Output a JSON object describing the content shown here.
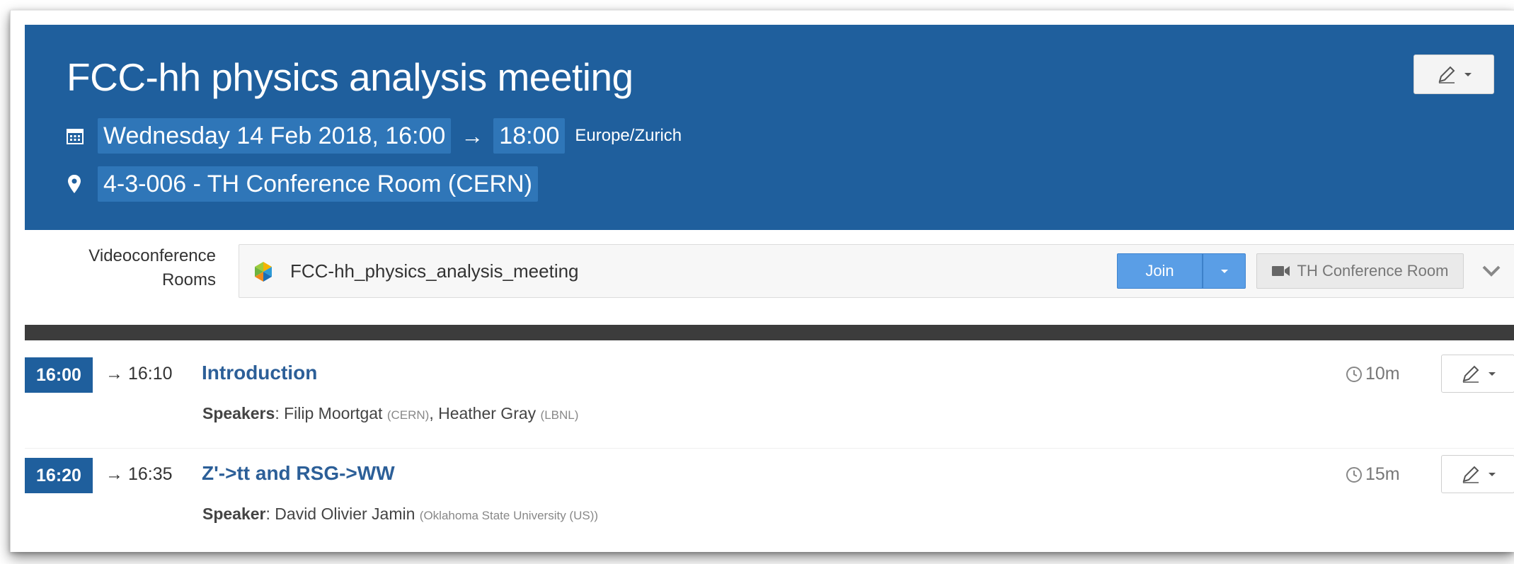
{
  "event": {
    "title": "FCC-hh physics analysis meeting",
    "date_start": "Wednesday 14 Feb 2018, 16:00",
    "arrow": "→",
    "time_end": "18:00",
    "timezone": "Europe/Zurich",
    "location": "4-3-006 - TH Conference Room (CERN)"
  },
  "videoconference": {
    "label": "Videoconference Rooms",
    "room_name": "FCC-hh_physics_analysis_meeting",
    "join_label": "Join",
    "room_button_label": "TH Conference Room"
  },
  "contributions": [
    {
      "start": "16:00",
      "end": "→ 16:10",
      "title": "Introduction",
      "speakers_label": "Speakers",
      "speakers": [
        {
          "name": "Filip Moortgat",
          "affiliation": "(CERN)"
        },
        {
          "name": "Heather Gray",
          "affiliation": "(LBNL)"
        }
      ],
      "duration": "10m"
    },
    {
      "start": "16:20",
      "end": "→ 16:35",
      "title": "Z'->tt and RSG->WW",
      "speakers_label": "Speaker",
      "speakers": [
        {
          "name": "David Olivier Jamin",
          "affiliation": "(Oklahoma State University (US))"
        }
      ],
      "duration": "15m"
    }
  ],
  "colors": {
    "header_bg": "#1f5f9d",
    "highlight_bg": "#2f76b8",
    "join_bg": "#5a9ee6",
    "title_link": "#2c5f98",
    "separator": "#3c3c3c"
  },
  "icons": {
    "calendar": "calendar-icon",
    "location": "map-pin-icon",
    "edit": "pencil-icon",
    "video": "video-camera-icon",
    "clock": "clock-icon",
    "expand": "chevron-down-icon",
    "vidyo": "vidyo-logo"
  }
}
